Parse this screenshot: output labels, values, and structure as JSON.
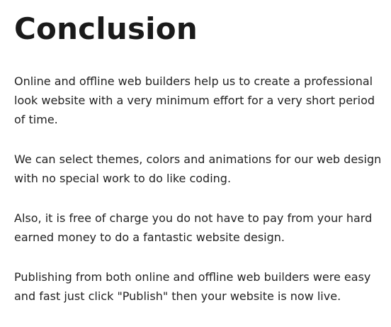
{
  "article": {
    "title": "Conclusion",
    "paragraphs": [
      "Online and offline web builders help us to create a professional look website with a very minimum effort for a very short period of time.",
      "We can select themes, colors and animations for our web design with no special work to do like coding.",
      "Also, it is free of charge you do not have to pay from your hard earned money to do a fantastic website design.",
      "Publishing from both online and offline web builders were easy and fast just click \"Publish\" then your website is now live."
    ]
  }
}
